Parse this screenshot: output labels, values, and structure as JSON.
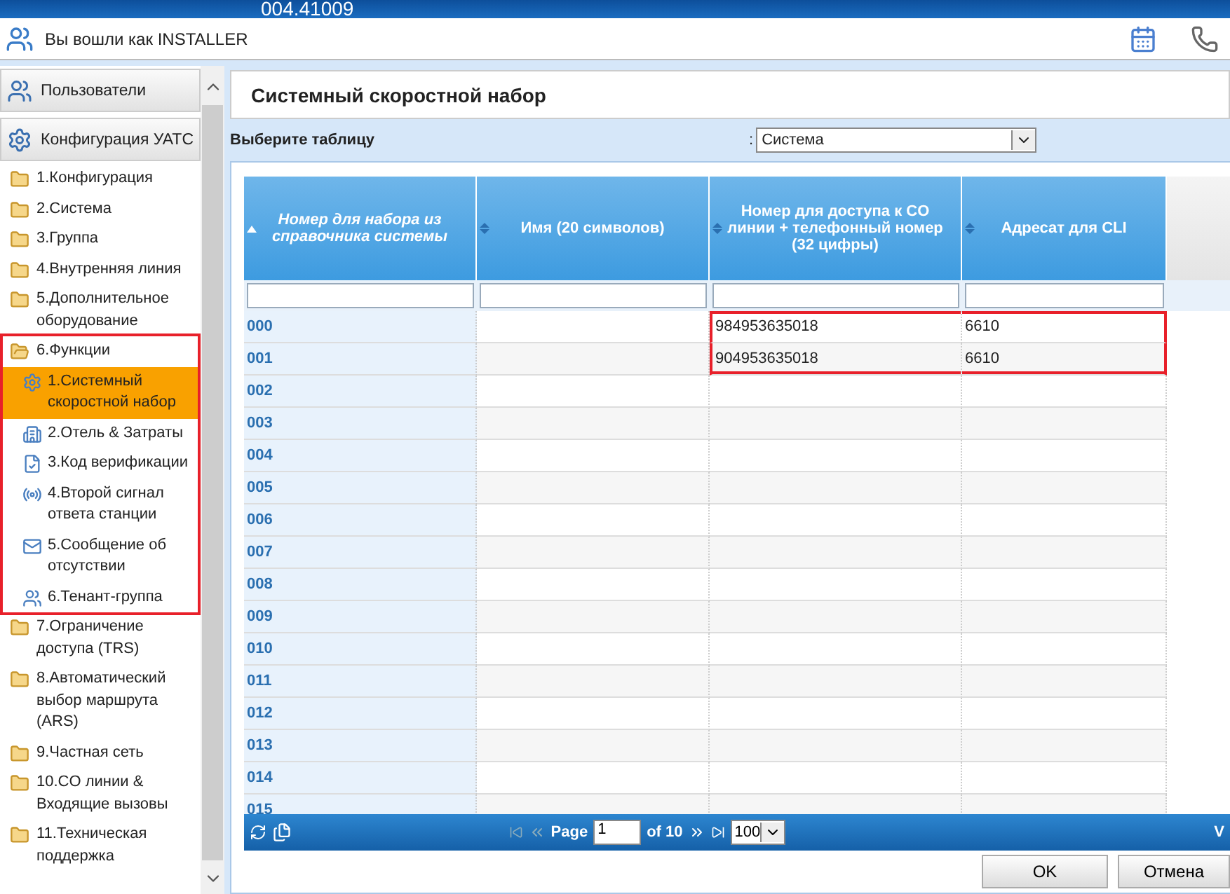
{
  "banner": {
    "version": "004.41009"
  },
  "user_bar": {
    "text": "Вы вошли как INSTALLER"
  },
  "sidebar": {
    "sections": [
      {
        "label": "Пользователи"
      },
      {
        "label": "Конфигурация УАТС"
      }
    ],
    "items": [
      {
        "label": "1.Конфигурация",
        "expanded": false,
        "marked": false
      },
      {
        "label": "2.Система",
        "expanded": false,
        "marked": false
      },
      {
        "label": "3.Группа",
        "expanded": false,
        "marked": false
      },
      {
        "label": "4.Внутренняя линия",
        "expanded": false,
        "marked": false
      },
      {
        "label": "5.Дополнительное оборудование",
        "expanded": false,
        "marked": false
      },
      {
        "label": "6.Функции",
        "expanded": true,
        "marked": true,
        "children": [
          {
            "label": "1.Системный скоростной набор",
            "selected": true
          },
          {
            "label": "2.Отель & Затраты",
            "selected": false
          },
          {
            "label": "3.Код верификации",
            "selected": false
          },
          {
            "label": "4.Второй сигнал ответа станции",
            "selected": false
          },
          {
            "label": "5.Сообщение об отсутствии",
            "selected": false
          },
          {
            "label": "6.Тенант-группа",
            "selected": false
          }
        ]
      },
      {
        "label": "7.Ограничение доступа (TRS)",
        "expanded": false,
        "marked": false
      },
      {
        "label": "8.Автоматический выбор маршрута (ARS)",
        "expanded": false,
        "marked": false
      },
      {
        "label": "9.Частная сеть",
        "expanded": false,
        "marked": false
      },
      {
        "label": "10.CO линии & Входящие вызовы",
        "expanded": false,
        "marked": false
      },
      {
        "label": "11.Техническая поддержка",
        "expanded": false,
        "marked": false
      }
    ]
  },
  "page": {
    "title": "Системный скоростной набор",
    "table_select": {
      "label": "Выберите таблицу",
      "separator": ":",
      "value": "Система"
    }
  },
  "table": {
    "columns": [
      {
        "label": "Номер для набора из справочника системы",
        "sorted": true
      },
      {
        "label": "Имя (20 символов)",
        "sorted": false
      },
      {
        "label": "Номер для доступа к CO линии + телефонный номер (32 цифры)",
        "sorted": false
      },
      {
        "label": "Адресат для CLI",
        "sorted": false
      }
    ],
    "rows": [
      {
        "number": "000",
        "phone": "984953635018",
        "cli": "6610",
        "marked": true
      },
      {
        "number": "001",
        "phone": "904953635018",
        "cli": "6610",
        "marked": true
      },
      {
        "number": "002",
        "marked": false
      },
      {
        "number": "003",
        "marked": false
      },
      {
        "number": "004",
        "marked": false
      },
      {
        "number": "005",
        "marked": false
      },
      {
        "number": "006",
        "marked": false
      },
      {
        "number": "007",
        "marked": false
      },
      {
        "number": "008",
        "marked": false
      },
      {
        "number": "009",
        "marked": false
      },
      {
        "number": "010",
        "marked": false
      },
      {
        "number": "011",
        "marked": false
      },
      {
        "number": "012",
        "marked": false
      },
      {
        "number": "013",
        "marked": false
      },
      {
        "number": "014",
        "marked": false
      },
      {
        "number": "015",
        "marked": false
      }
    ]
  },
  "pager": {
    "page_label": "Page",
    "page": "1",
    "of": "of 10",
    "page_size": "100",
    "view": "V"
  },
  "buttons": [
    "OK",
    "Отмена"
  ]
}
